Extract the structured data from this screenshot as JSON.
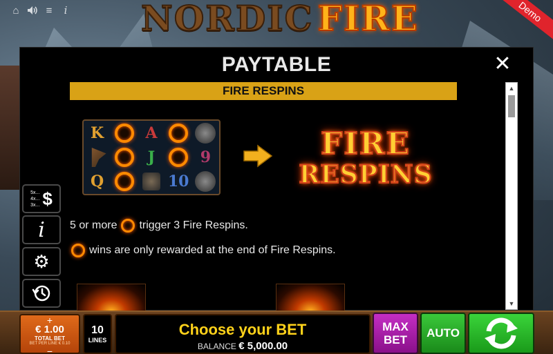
{
  "top_bar": {
    "icons": [
      "home-icon",
      "sound-icon",
      "menu-icon",
      "info-icon"
    ],
    "logo_word_1": "NORDIC",
    "logo_word_2": "FIRE",
    "demo_label": "Demo"
  },
  "paytable": {
    "title": "PAYTABLE",
    "section_title": "FIRE RESPINS",
    "art_line_1": "FIRE",
    "art_line_2": "RESPINS",
    "rule_1_prefix": "5 or more",
    "rule_1_suffix": "trigger 3 Fire Respins.",
    "rule_2_text": "wins are only rewarded at the end of Fire Respins.",
    "reel_grid": [
      [
        "K",
        "ring",
        "A",
        "ring",
        "viking"
      ],
      [
        "axe",
        "ring",
        "J",
        "ring",
        "9"
      ],
      [
        "Q",
        "ring",
        "knot",
        "10",
        "viking"
      ]
    ]
  },
  "side_buttons": {
    "paytable_lines": [
      "5x...",
      "4x...",
      "3x..."
    ],
    "paytable_symbol": "$",
    "info_symbol": "i"
  },
  "bottom_bar": {
    "bet_plus": "+",
    "bet_amount": "€ 1.00",
    "bet_label": "TOTAL BET",
    "bet_per_line": "BET PER LINE € 0.10",
    "bet_minus": "−",
    "lines_value": "10",
    "lines_label": "LINES",
    "message": "Choose your BET",
    "balance_label": "BALANCE",
    "balance_value": "€ 5,000.00",
    "max_bet_label_1": "MAX",
    "max_bet_label_2": "BET",
    "auto_label": "AUTO"
  },
  "colors": {
    "section_bar": "#d9a216",
    "message_text": "#ffd21a",
    "bet_box": "#e06a1a",
    "max_bet": "#c42ec4",
    "auto": "#3ac83a",
    "spin": "#3ad43a"
  }
}
